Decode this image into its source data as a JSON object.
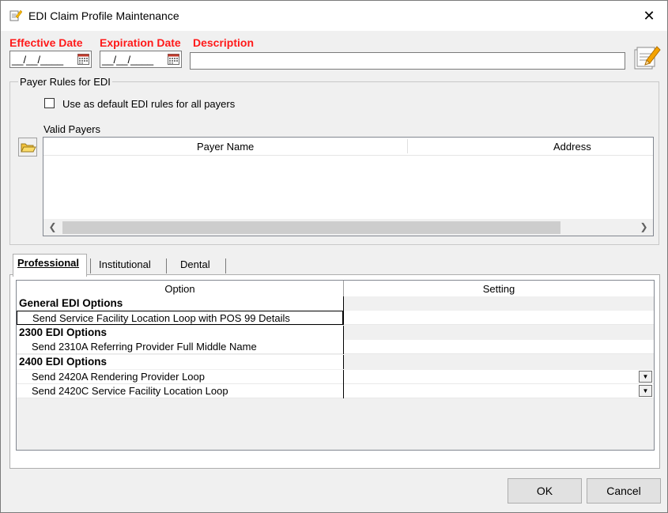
{
  "window": {
    "title": "EDI Claim Profile Maintenance",
    "close_glyph": "✕"
  },
  "header": {
    "effective_date_label": "Effective Date",
    "expiration_date_label": "Expiration Date",
    "description_label": "Description",
    "effective_date_value": "__/__/____",
    "expiration_date_value": "__/__/____",
    "description_value": ""
  },
  "payer_rules": {
    "group_title": "Payer Rules for EDI",
    "default_checkbox_label": "Use as default EDI rules for all payers",
    "default_checked": false,
    "valid_payers_label": "Valid Payers",
    "columns": [
      "Payer Name",
      "Address"
    ]
  },
  "tabs": [
    {
      "label": "Professional",
      "active": true
    },
    {
      "label": "Institutional",
      "active": false
    },
    {
      "label": "Dental",
      "active": false
    }
  ],
  "options_grid": {
    "columns": [
      "Option",
      "Setting"
    ],
    "rows": [
      {
        "type": "group",
        "label": "General EDI Options"
      },
      {
        "type": "item",
        "label": "Send Service Facility Location Loop with POS 99 Details",
        "selected": true,
        "dropdown": false
      },
      {
        "type": "group",
        "label": "2300 EDI Options"
      },
      {
        "type": "item",
        "label": "Send 2310A Referring Provider Full Middle Name",
        "dropdown": false
      },
      {
        "type": "group",
        "label": "2400 EDI Options"
      },
      {
        "type": "item",
        "label": "Send 2420A Rendering Provider Loop",
        "dropdown": true
      },
      {
        "type": "item",
        "label": "Send 2420C Service Facility Location Loop",
        "dropdown": true
      }
    ]
  },
  "buttons": {
    "ok": "OK",
    "cancel": "Cancel"
  },
  "colors": {
    "required_label": "#ff1a1a",
    "window_bg": "#f0f0f0",
    "button_bg": "#e1e1e1"
  }
}
